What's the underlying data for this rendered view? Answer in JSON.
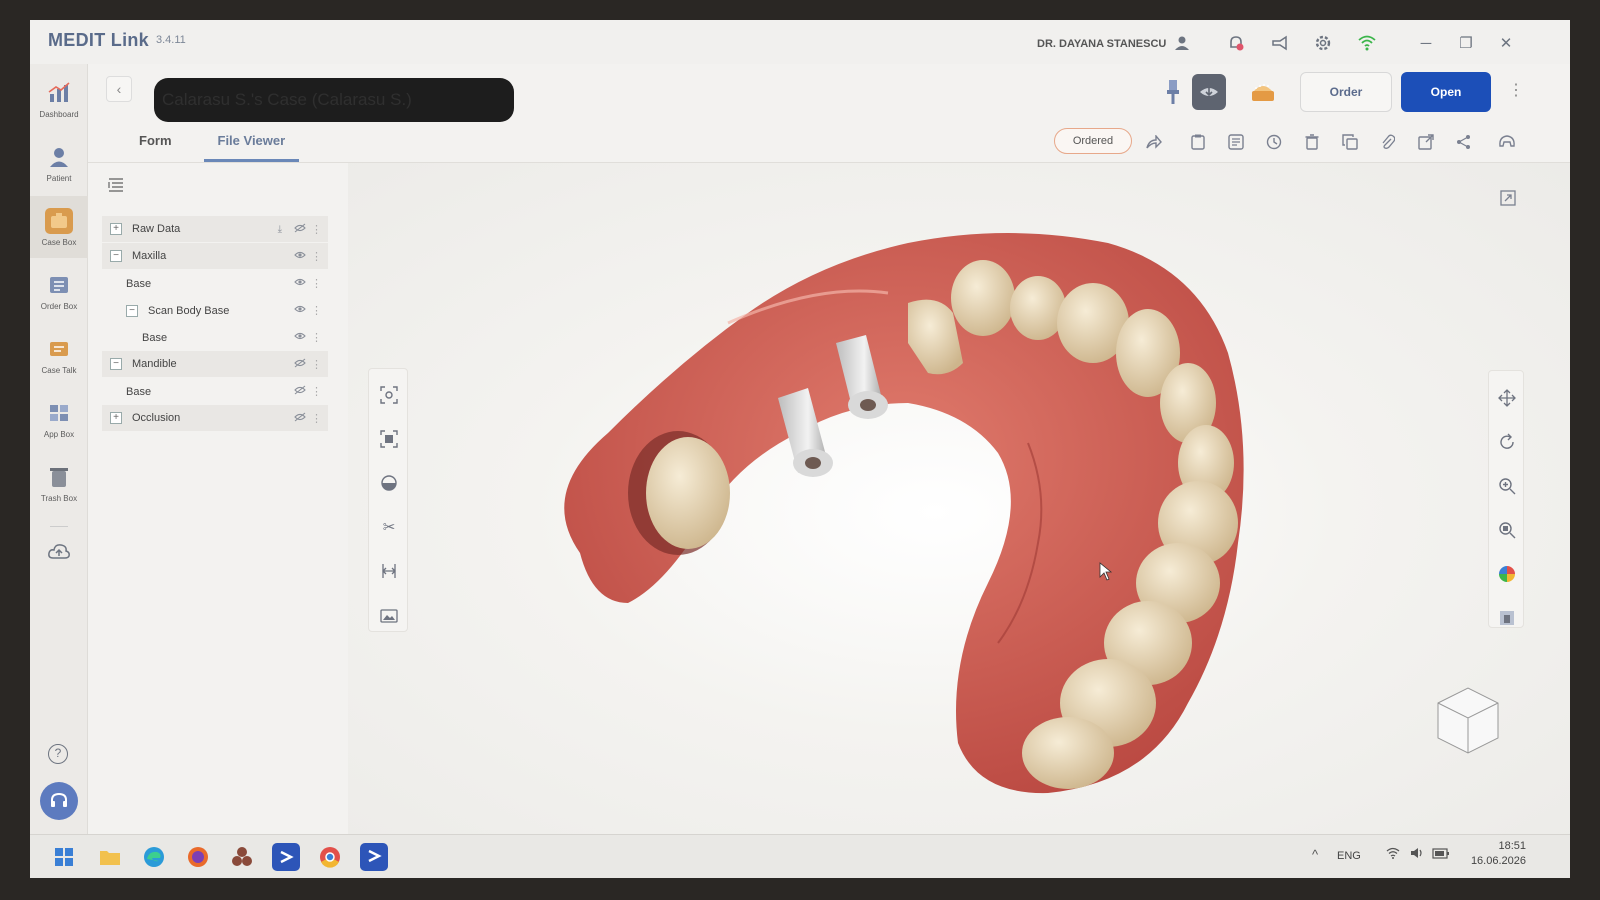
{
  "app": {
    "title": "MEDIT Link",
    "version": "3.4.11",
    "user_name": "DR. DAYANA STANESCU"
  },
  "nav": {
    "items": [
      {
        "label": "Dashboard",
        "icon": "chart-icon"
      },
      {
        "label": "Patient",
        "icon": "person-icon"
      },
      {
        "label": "Case Box",
        "icon": "case-box-icon"
      },
      {
        "label": "Order Box",
        "icon": "order-box-icon"
      },
      {
        "label": "Case Talk",
        "icon": "case-talk-icon"
      },
      {
        "label": "App Box",
        "icon": "app-box-icon"
      },
      {
        "label": "Trash Box",
        "icon": "trash-icon"
      }
    ]
  },
  "case": {
    "title": "Calarasu S.'s Case (Calarasu S.)",
    "tabs": [
      "Form",
      "File Viewer"
    ],
    "active_tab": "File Viewer",
    "status": "Ordered"
  },
  "actions": {
    "order_label": "Order",
    "open_label": "Open"
  },
  "tree": {
    "rows": [
      {
        "label": "Raw Data",
        "type": "group",
        "expander": "+",
        "visible": false,
        "download": true
      },
      {
        "label": "Maxilla",
        "type": "group",
        "expander": "−",
        "visible": true
      },
      {
        "label": "Base",
        "type": "child",
        "visible": true
      },
      {
        "label": "Scan Body Base",
        "type": "subgroup",
        "expander": "−",
        "visible": true
      },
      {
        "label": "Base",
        "type": "grandchild",
        "visible": true
      },
      {
        "label": "Mandible",
        "type": "group",
        "expander": "−",
        "visible": false
      },
      {
        "label": "Base",
        "type": "child",
        "visible": false
      },
      {
        "label": "Occlusion",
        "type": "group",
        "expander": "+",
        "visible": false
      }
    ]
  },
  "taskbar": {
    "language": "ENG",
    "time": "18:51",
    "date": "16.06.2026"
  },
  "colors": {
    "accent": "#1c4fb8",
    "status_border": "#e7a88a",
    "gum": "#c9574d",
    "tooth": "#e8d9b8"
  }
}
